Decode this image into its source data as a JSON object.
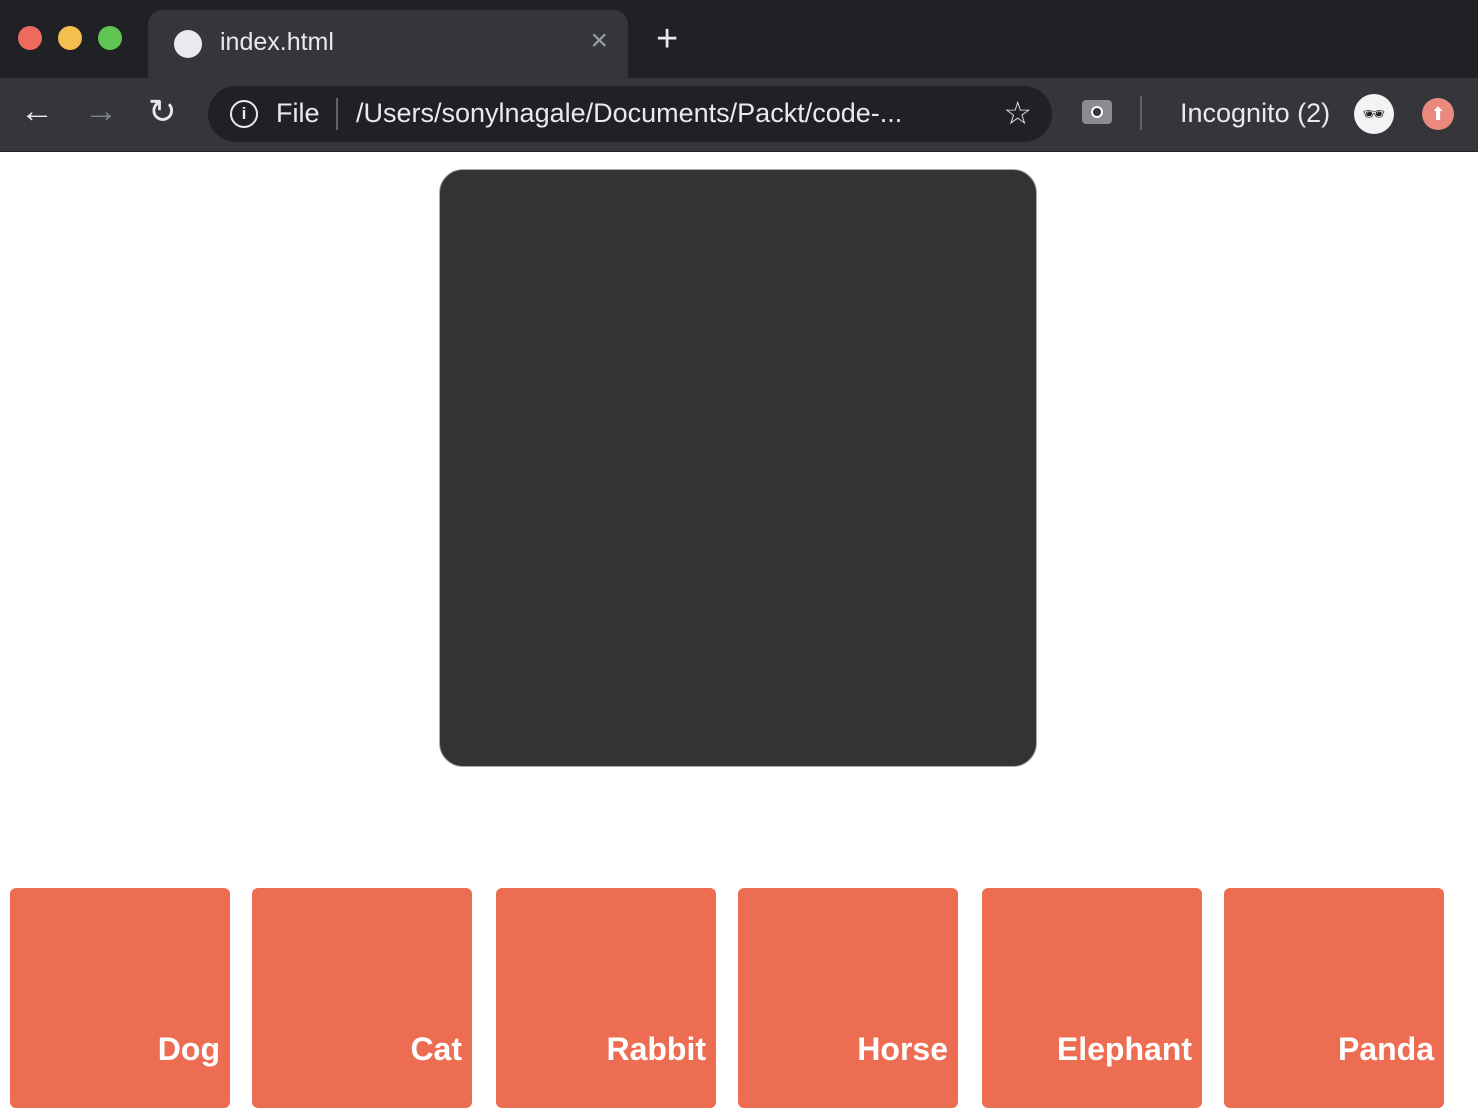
{
  "browser": {
    "tab_title": "index.html",
    "tab_close": "×",
    "new_tab": "+",
    "back": "←",
    "forward": "→",
    "reload": "↻",
    "info": "i",
    "scheme_label": "File",
    "url": "/Users/sonylnagale/Documents/Packt/code-...",
    "star": "☆",
    "incognito_label": "Incognito (2)",
    "incognito_icon": "🕶",
    "update_icon": "⬆"
  },
  "cards": [
    "Dog",
    "Cat",
    "Rabbit",
    "Horse",
    "Elephant",
    "Panda"
  ],
  "colors": {
    "card": "#ec6d52",
    "stage": "#333333"
  }
}
